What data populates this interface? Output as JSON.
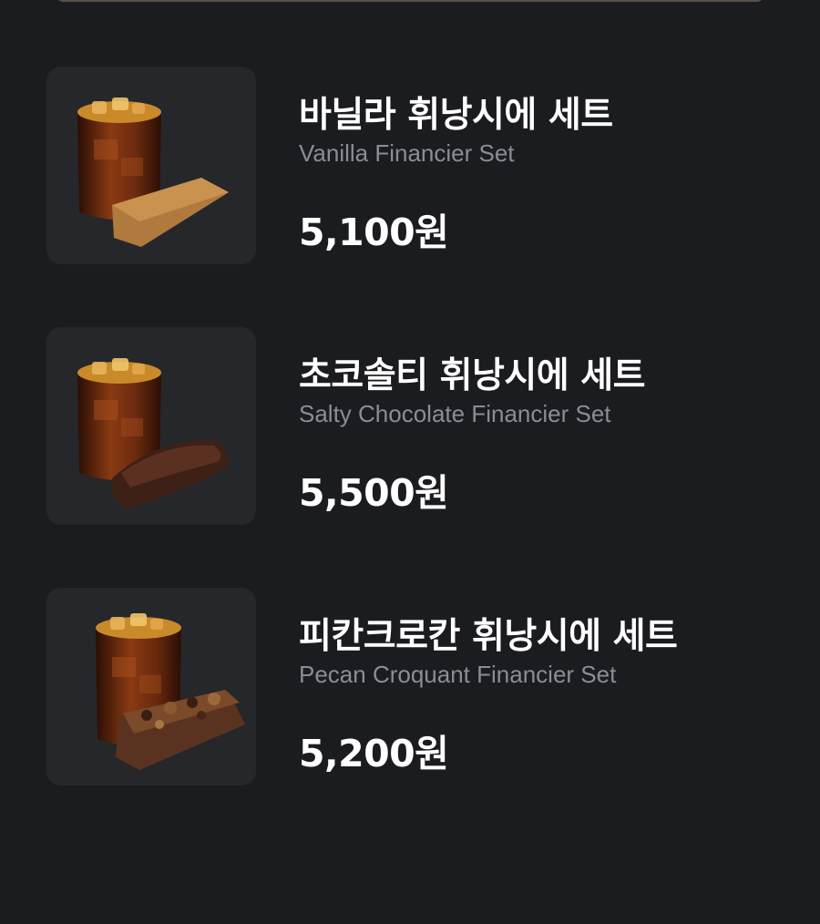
{
  "colors": {
    "background": "#1b1c1f",
    "card": "#26272b",
    "title": "#ffffff",
    "subtitle": "#8c8d93",
    "coffee": "#6b2a0f",
    "financier_vanilla": "#b07a3e",
    "financier_chocolate": "#3d2016",
    "financier_pecan": "#5a3320"
  },
  "menu": {
    "items": [
      {
        "name_ko": "바닐라 휘낭시에 세트",
        "name_en": "Vanilla Financier Set",
        "price": "5,100원",
        "image_icon": "iced-coffee-vanilla-financier-image"
      },
      {
        "name_ko": "초코솔티 휘낭시에 세트",
        "name_en": "Salty Chocolate Financier Set",
        "price": "5,500원",
        "image_icon": "iced-coffee-chocolate-financier-image"
      },
      {
        "name_ko": "피칸크로칸 휘낭시에 세트",
        "name_en": "Pecan Croquant Financier Set",
        "price": "5,200원",
        "image_icon": "iced-coffee-pecan-financier-image"
      }
    ]
  }
}
